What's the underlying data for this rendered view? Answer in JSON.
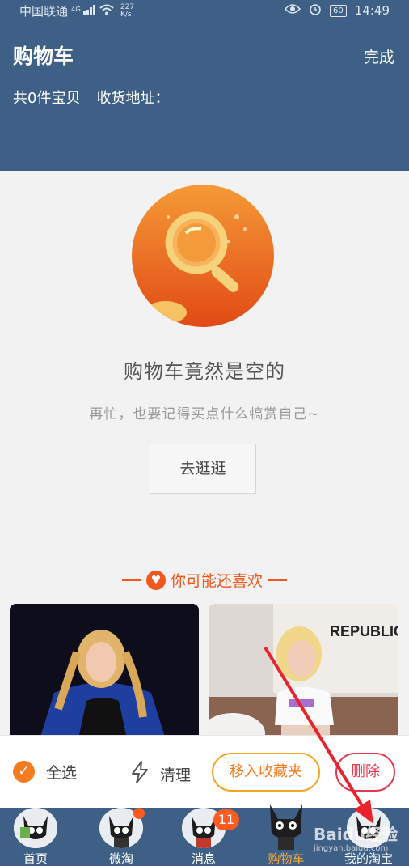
{
  "status": {
    "carrier": "中国联通",
    "network": "4G",
    "speed_value": "227",
    "speed_unit": "K/s",
    "battery": "60",
    "time": "14:49"
  },
  "header": {
    "title": "购物车",
    "done_label": "完成",
    "item_count_text": "共0件宝贝",
    "address_label": "收货地址："
  },
  "empty": {
    "title": "购物车竟然是空的",
    "subtitle": "再忙，也要记得买点什么犒赏自己~",
    "go_button": "去逛逛"
  },
  "recommend": {
    "heading": "你可能还喜欢",
    "heading_icon": "heart-icon"
  },
  "products": [
    {
      "image": "product-image-woman-blue-jacket",
      "shirt_text": ""
    },
    {
      "image": "product-image-woman-white-top",
      "shirt_text": "REPUBLIC"
    }
  ],
  "action_bar": {
    "select_all": "全选",
    "clear": "清理",
    "move_to_favorites": "移入收藏夹",
    "delete": "删除"
  },
  "tabs": [
    {
      "label": "首页",
      "badge": ""
    },
    {
      "label": "微淘",
      "badge": "dot"
    },
    {
      "label": "消息",
      "badge": "11"
    },
    {
      "label": "购物车",
      "badge": "",
      "active": true
    },
    {
      "label": "我的淘宝",
      "badge": ""
    }
  ],
  "watermark": {
    "brand": "Baidu经验",
    "url": "jingyan.baidu.com"
  },
  "colors": {
    "header_bg": "#3e6086",
    "accent_orange": "#f47b20",
    "delete_red": "#e8384f",
    "active_tab": "#f7a93a"
  }
}
